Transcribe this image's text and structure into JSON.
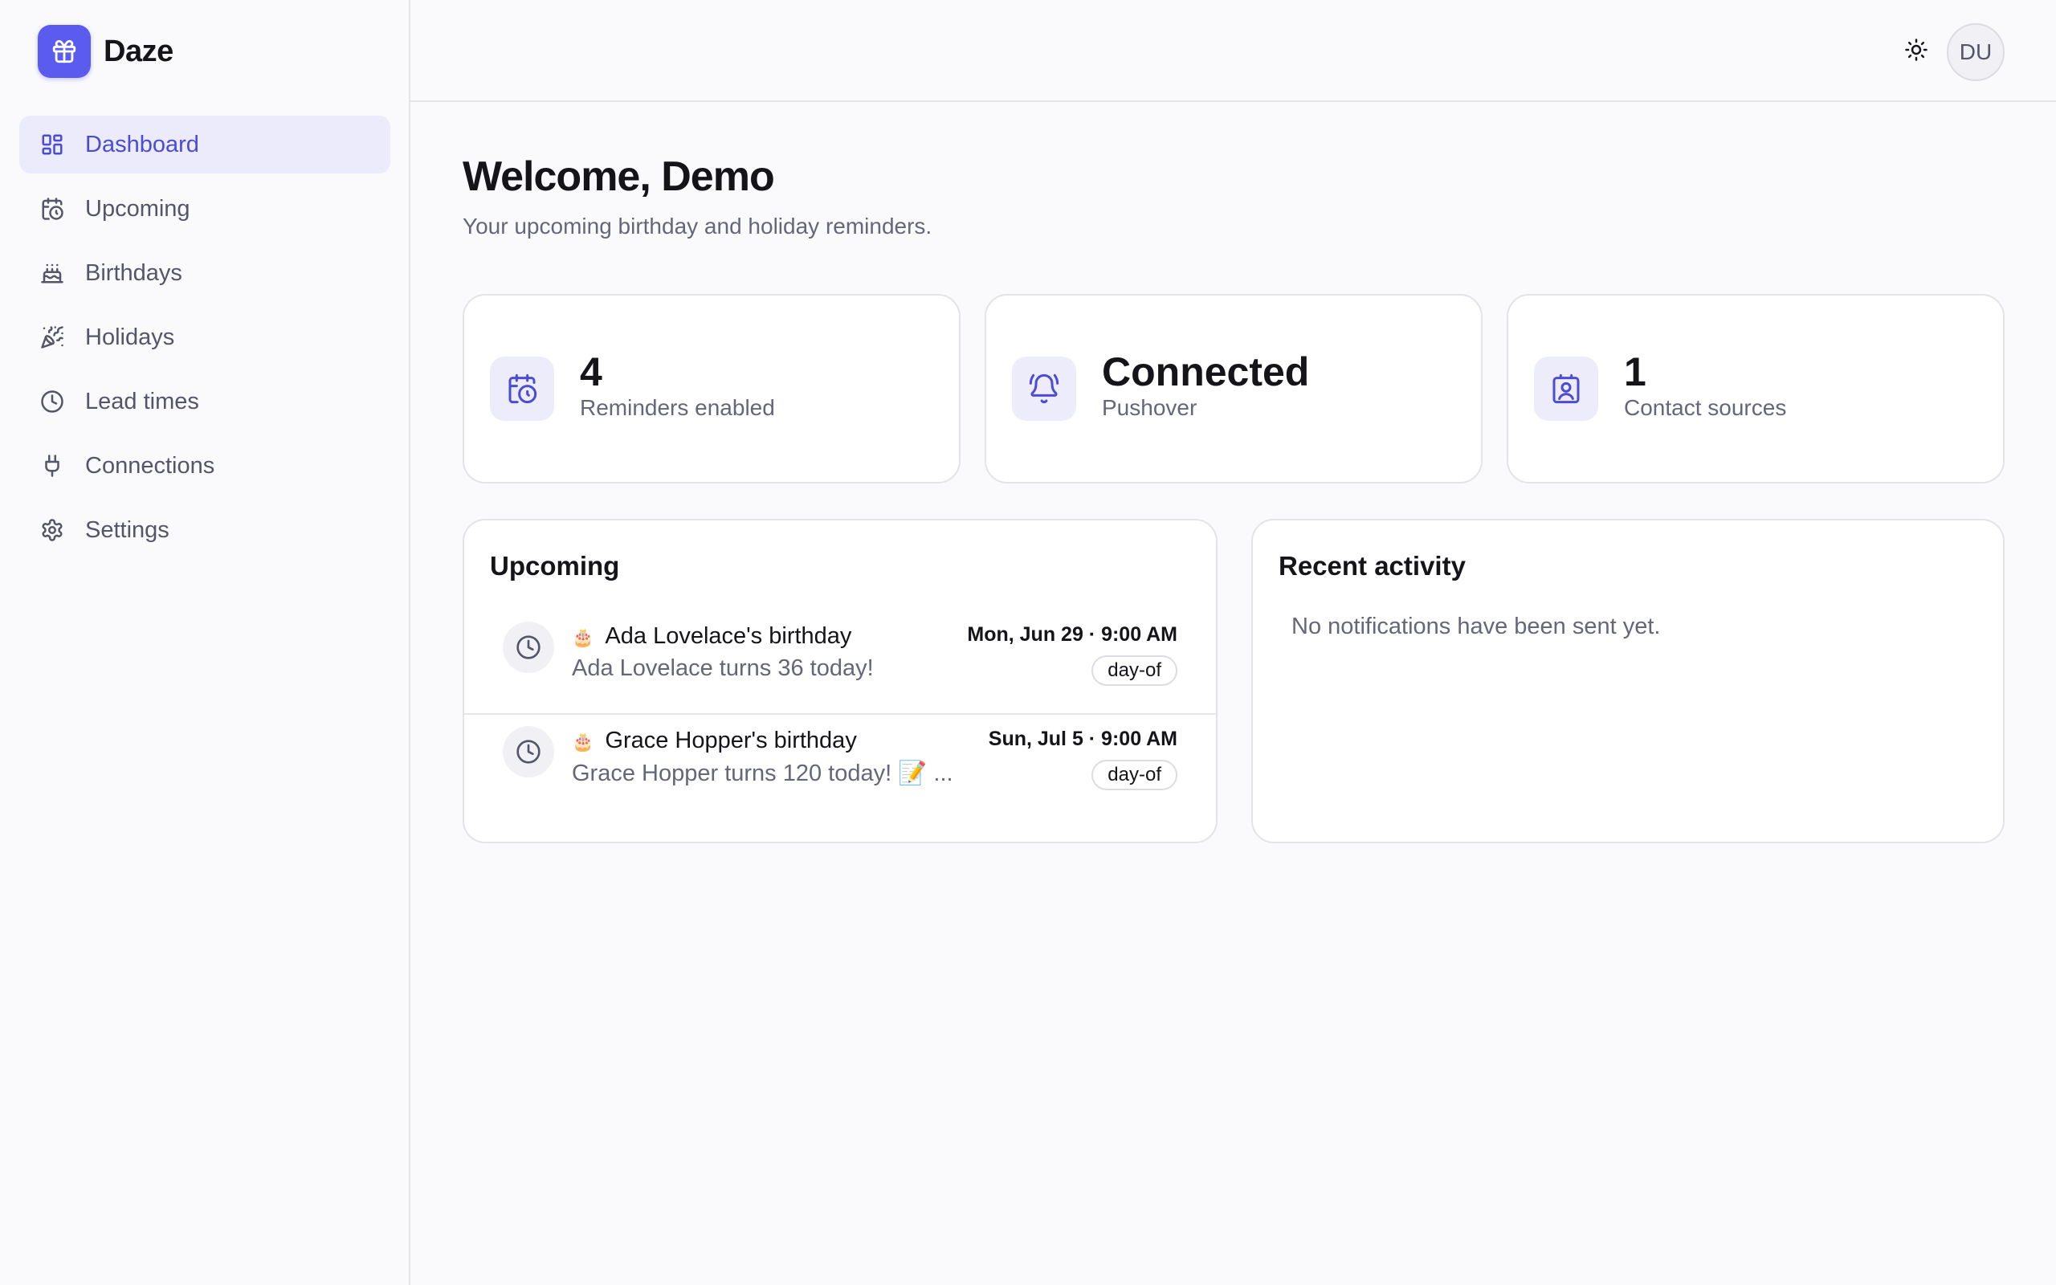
{
  "brand": {
    "name": "Daze",
    "icon": "gift-icon",
    "color": "#5b5bf0"
  },
  "nav": {
    "items": [
      {
        "label": "Dashboard",
        "icon": "dashboard-icon",
        "active": true
      },
      {
        "label": "Upcoming",
        "icon": "calendar-clock-icon"
      },
      {
        "label": "Birthdays",
        "icon": "cake-icon"
      },
      {
        "label": "Holidays",
        "icon": "party-popper-icon"
      },
      {
        "label": "Lead times",
        "icon": "clock-icon"
      },
      {
        "label": "Connections",
        "icon": "plug-icon"
      },
      {
        "label": "Settings",
        "icon": "gear-icon"
      }
    ]
  },
  "topbar": {
    "theme_icon": "sun-icon",
    "avatar_initials": "DU"
  },
  "page": {
    "title": "Welcome, Demo",
    "subtitle": "Your upcoming birthday and holiday reminders."
  },
  "stats": [
    {
      "value": "4",
      "label": "Reminders enabled",
      "icon": "calendar-clock-icon"
    },
    {
      "value": "Connected",
      "label": "Pushover",
      "icon": "bell-ring-icon"
    },
    {
      "value": "1",
      "label": "Contact sources",
      "icon": "contact-icon"
    }
  ],
  "upcoming": {
    "title": "Upcoming",
    "items": [
      {
        "emoji": "🎂",
        "title": "Ada Lovelace's birthday",
        "subtitle": "Ada Lovelace turns 36 today!",
        "date": "Mon, Jun 29 · 9:00 AM",
        "badge": "day-of"
      },
      {
        "emoji": "🎂",
        "title": "Grace Hopper's birthday",
        "subtitle": "Grace Hopper turns 120 today! 📝 ...",
        "date": "Sun, Jul 5 · 9:00 AM",
        "badge": "day-of"
      }
    ]
  },
  "recent_activity": {
    "title": "Recent activity",
    "empty_text": "No notifications have been sent yet."
  },
  "colors": {
    "accent": "#4b4bd6",
    "accent_bg": "#ebebfb",
    "muted_text": "#66667a"
  }
}
